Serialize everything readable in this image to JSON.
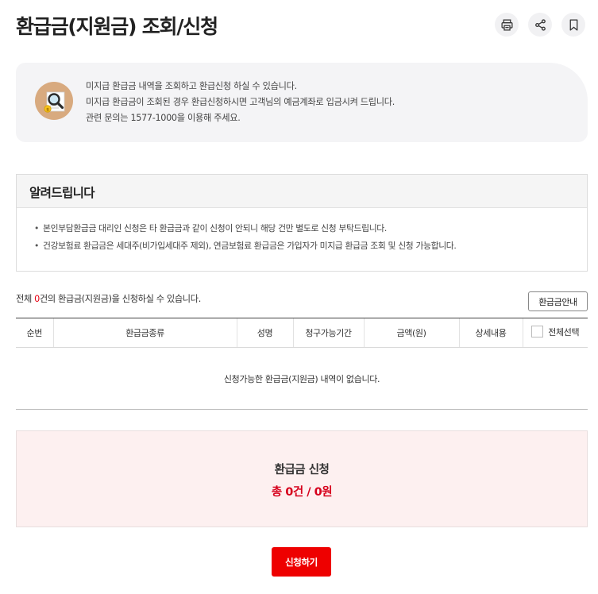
{
  "page": {
    "title": "환급금(지원금) 조회/신청"
  },
  "toolbar": {
    "print_icon": "printer-icon",
    "share_icon": "share-icon",
    "bookmark_icon": "bookmark-icon"
  },
  "intro": {
    "icon": "magnifier-document-icon",
    "lines": [
      "미지급 환급금 내역을 조회하고 환급신청 하실 수 있습니다.",
      "미지급 환급금이 조회된 경우 환급신청하시면 고객님의 예금계좌로 입금시켜 드립니다.",
      "관련 문의는 1577-1000을 이용해 주세요."
    ]
  },
  "notice": {
    "title": "알려드립니다",
    "items": [
      "본인부담환급금 대리인 신청은 타 환급금과 같이 신청이 안되니 해당 건만 별도로 신청 부탁드립니다.",
      "건강보험료 환급금은 세대주(비가입세대주 제외), 연금보험료 환급금은 가입자가 미지급 환급금 조회 및 신청 가능합니다."
    ]
  },
  "summary": {
    "prefix": "전체 ",
    "count": "0",
    "suffix": "건의 환급금(지원금)을 신청하실 수 있습니다.",
    "guide_button": "환급금안내"
  },
  "table": {
    "headers": [
      "순번",
      "환급금종류",
      "성명",
      "청구가능기간",
      "금액(원)",
      "상세내용",
      "전체선택"
    ],
    "empty_message": "신청가능한 환급금(지원금) 내역이 없습니다."
  },
  "apply": {
    "title": "환급금 신청",
    "total": "총 0건 / 0원"
  },
  "submit_button": "신청하기",
  "colors": {
    "accent": "#ee0000",
    "total_text": "#d6001c",
    "apply_bg": "#fdf0f0"
  }
}
